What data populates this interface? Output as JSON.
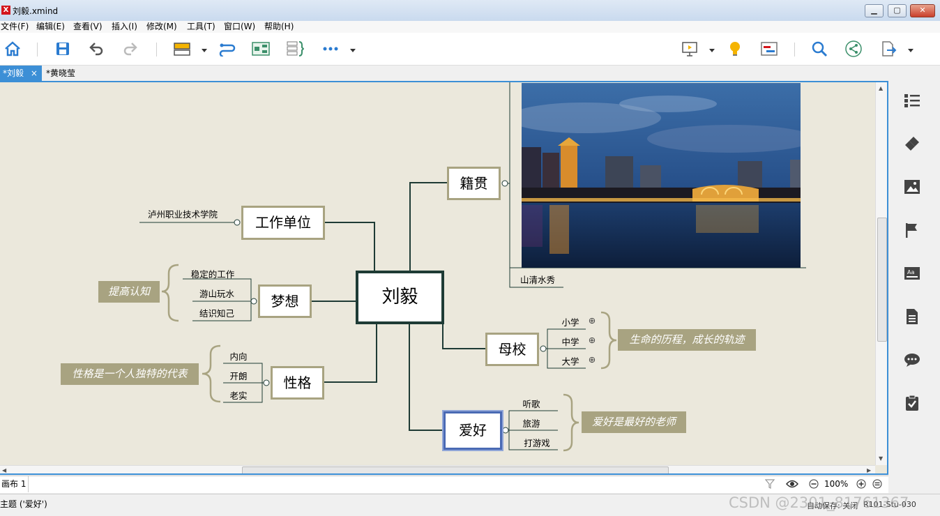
{
  "window": {
    "title": "刘毅.xmind",
    "app_icon": "X"
  },
  "menu": [
    "文件(F)",
    "编辑(E)",
    "查看(V)",
    "插入(I)",
    "修改(M)",
    "工具(T)",
    "窗口(W)",
    "帮助(H)"
  ],
  "tabs": {
    "active": "*刘毅",
    "close": "×",
    "other": "*黄晓莹"
  },
  "map": {
    "central": "刘毅",
    "jiguan": "籍贯",
    "image_caption": "山清水秀",
    "work": "工作单位",
    "work_sub": "泸州职业技术学院",
    "dream": "梦想",
    "dream_subs": [
      "稳定的工作",
      "游山玩水",
      "结识知己"
    ],
    "dream_summary": "提高认知",
    "personality": "性格",
    "personality_subs": [
      "内向",
      "开朗",
      "老实"
    ],
    "personality_summary": "性格是一个人独特的代表",
    "school": "母校",
    "school_subs": [
      "小学",
      "中学",
      "大学"
    ],
    "school_summary": "生命的历程，成长的轨迹",
    "hobby": "爱好",
    "hobby_subs": [
      "听歌",
      "旅游",
      "打游戏"
    ],
    "hobby_summary": "爱好是最好的老师",
    "collapse_symbol": "⊕"
  },
  "sheet": {
    "name": "画布 1",
    "zoom": "100%"
  },
  "status": {
    "text": "主题 ('爱好')",
    "autosave": "自动保存: 关闭",
    "user": "R101-Stu-030",
    "watermark": "CSDN @2301_81761367"
  },
  "colors": {
    "accent": "#3c8fd6",
    "canvas": "#ebe8dc",
    "topic_border": "#a8a381",
    "line": "#1e3b35"
  }
}
